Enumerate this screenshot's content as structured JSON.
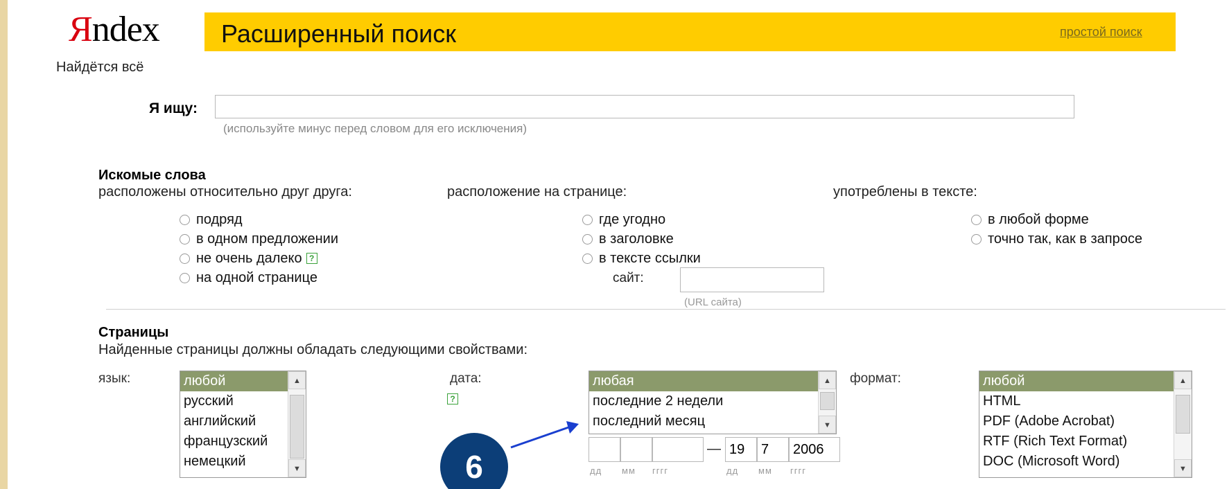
{
  "header": {
    "logo": {
      "first": "Я",
      "rest": "ndex"
    },
    "slogan": "Найдётся всё",
    "title": "Расширенный поиск",
    "simple_search_link": "простой поиск"
  },
  "query": {
    "label": "Я ищу:",
    "value": "",
    "hint": "(используйте минус перед словом для его исключения)"
  },
  "words_section": {
    "title": "Искомые слова",
    "col1": {
      "label": "расположены относительно друг друга:",
      "options": [
        "подряд",
        "в одном предложении",
        "не очень далеко",
        "на одной странице"
      ]
    },
    "col2": {
      "label": "расположение на странице:",
      "options": [
        "где угодно",
        "в заголовке",
        "в тексте ссылки"
      ],
      "site_label": "сайт:",
      "site_hint": "(URL сайта)"
    },
    "col3": {
      "label": "употреблены в тексте:",
      "options": [
        "в любой форме",
        "точно так, как в запросе"
      ]
    },
    "help_icon": "?"
  },
  "pages_section": {
    "title": "Страницы",
    "subtitle": "Найденные страницы должны обладать следующими свойствами:",
    "language": {
      "label": "язык:",
      "options": [
        "любой",
        "русский",
        "английский",
        "французский",
        "немецкий"
      ],
      "selected": "любой"
    },
    "date": {
      "label": "дата:",
      "help_icon": "?",
      "options": [
        "любая",
        "последние 2 недели",
        "последний месяц"
      ],
      "selected": "любая",
      "from": {
        "dd": "",
        "mm": "",
        "yyyy": ""
      },
      "dash": "—",
      "to": {
        "dd": "19",
        "mm": "7",
        "yyyy": "2006"
      },
      "hints": {
        "dd": "дд",
        "mm": "мм",
        "yyyy": "гггг"
      }
    },
    "format": {
      "label": "формат:",
      "options": [
        "любой",
        "HTML",
        "PDF (Adobe Acrobat)",
        "RTF (Rich Text Format)",
        "DOC (Microsoft Word)"
      ],
      "selected": "любой"
    }
  },
  "annotation": {
    "number": "6",
    "color": "#0c3e78",
    "arrow_color": "#1a3fcf"
  },
  "colors": {
    "banner": "#ffcc00",
    "selected_option": "#8b9a6b",
    "frame": "#e9d6a4"
  }
}
